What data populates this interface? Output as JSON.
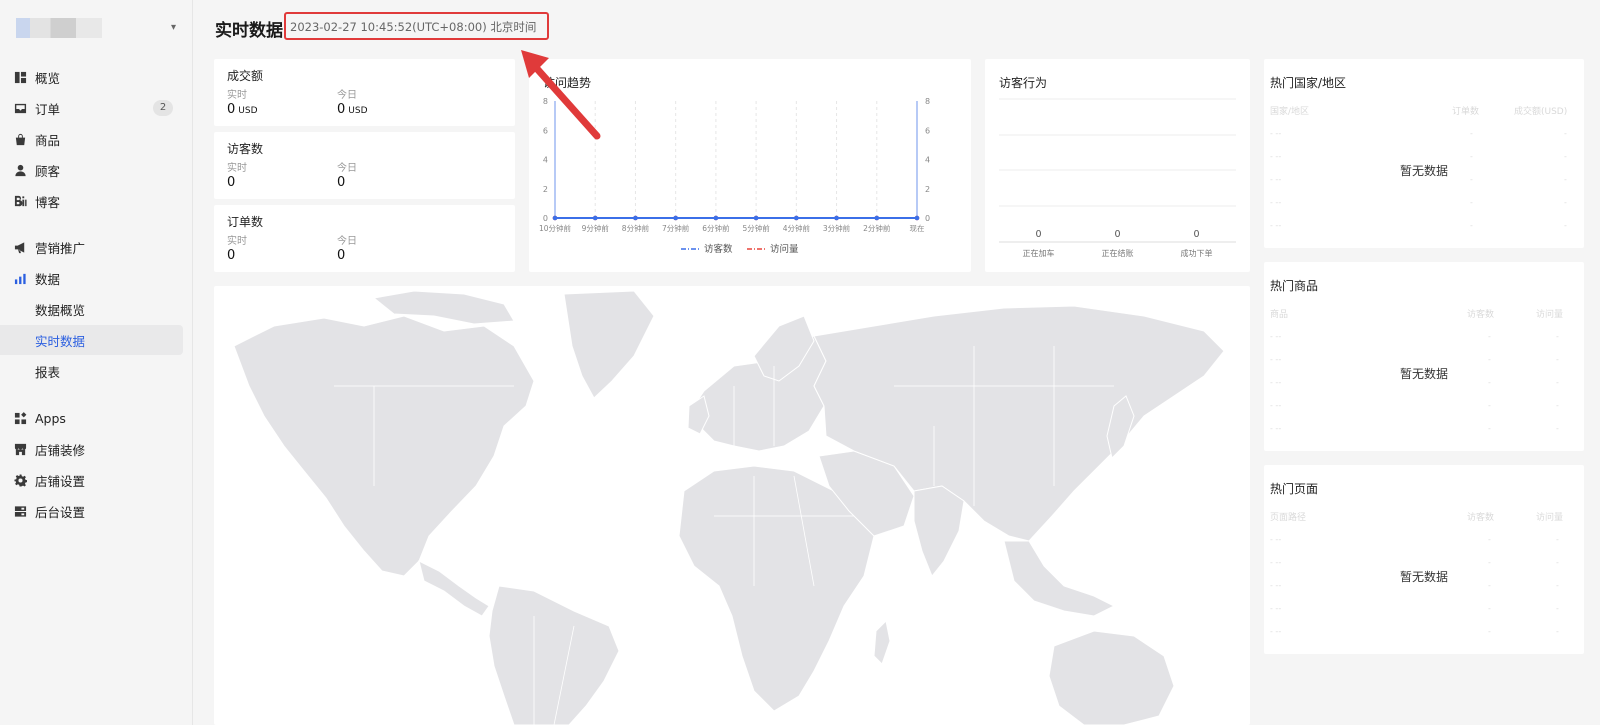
{
  "sidebar": {
    "store_caret": "▾",
    "items": [
      {
        "label": "概览",
        "icon": "dashboard-icon"
      },
      {
        "label": "订单",
        "icon": "inbox-icon",
        "badge": "2"
      },
      {
        "label": "商品",
        "icon": "bag-icon"
      },
      {
        "label": "顾客",
        "icon": "person-icon"
      },
      {
        "label": "博客",
        "icon": "blog-icon"
      },
      {
        "label": "营销推广",
        "icon": "megaphone-icon"
      },
      {
        "label": "数据",
        "icon": "bar-chart-icon"
      },
      {
        "label": "Apps",
        "icon": "apps-icon"
      },
      {
        "label": "店铺装修",
        "icon": "storefront-icon"
      },
      {
        "label": "店铺设置",
        "icon": "gear-icon"
      },
      {
        "label": "后台设置",
        "icon": "server-icon"
      }
    ],
    "sub_items": [
      {
        "label": "数据概览"
      },
      {
        "label": "实时数据"
      },
      {
        "label": "报表"
      }
    ]
  },
  "header": {
    "title": "实时数据",
    "datetime": "2023-02-27 10:45:52(UTC+08:00) 北京时间"
  },
  "metrics": [
    {
      "title": "成交额",
      "realtime_label": "实时",
      "today_label": "今日",
      "realtime_value": "0",
      "today_value": "0",
      "unit": "USD"
    },
    {
      "title": "访客数",
      "realtime_label": "实时",
      "today_label": "今日",
      "realtime_value": "0",
      "today_value": "0"
    },
    {
      "title": "订单数",
      "realtime_label": "实时",
      "today_label": "今日",
      "realtime_value": "0",
      "today_value": "0"
    }
  ],
  "trend": {
    "title": "访问趋势",
    "legend": [
      "访客数",
      "访问量"
    ]
  },
  "behavior": {
    "title": "访客行为"
  },
  "ranks": [
    {
      "title": "热门国家/地区",
      "columns": [
        "国家/地区",
        "订单数",
        "成交额(USD)"
      ],
      "empty": "暂无数据"
    },
    {
      "title": "热门商品",
      "columns": [
        "商品",
        "访客数",
        "访问量"
      ],
      "empty": "暂无数据"
    },
    {
      "title": "热门页面",
      "columns": [
        "页面路径",
        "访客数",
        "访问量"
      ],
      "empty": "暂无数据"
    }
  ],
  "placeholder_dash": "-",
  "colors": {
    "accent": "#2b5fe0",
    "visitors": "#3b6fe8",
    "views": "#e8453c",
    "highlight": "#e03a3a"
  },
  "chart_data": [
    {
      "type": "line",
      "title": "访问趋势",
      "categories": [
        "10分钟前",
        "9分钟前",
        "8分钟前",
        "7分钟前",
        "6分钟前",
        "5分钟前",
        "4分钟前",
        "3分钟前",
        "2分钟前",
        "现在"
      ],
      "series": [
        {
          "name": "访客数",
          "values": [
            0,
            0,
            0,
            0,
            0,
            0,
            0,
            0,
            0,
            0
          ]
        },
        {
          "name": "访问量",
          "values": [
            0,
            0,
            0,
            0,
            0,
            0,
            0,
            0,
            0,
            0
          ]
        }
      ],
      "ylim": [
        0,
        8
      ],
      "yticks": [
        0,
        2,
        4,
        6,
        8
      ],
      "legend": "bottom",
      "grid": true
    },
    {
      "type": "bar",
      "title": "访客行为",
      "categories": [
        "正在加车",
        "正在结账",
        "成功下单"
      ],
      "values": [
        0,
        0,
        0
      ],
      "grid": true
    }
  ]
}
